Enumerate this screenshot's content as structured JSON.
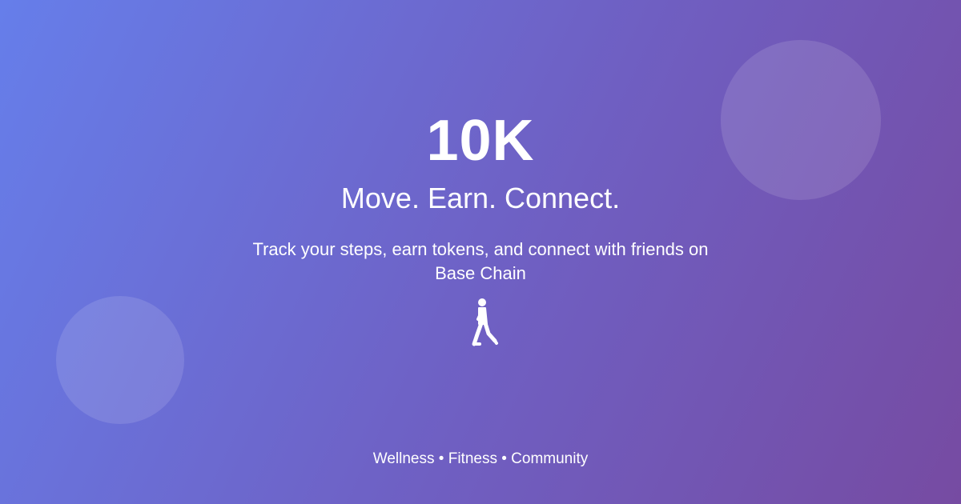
{
  "brand": {
    "title": "10K",
    "tagline": "Move. Earn. Connect.",
    "description": "Track your steps, earn tokens, and connect with friends on Base Chain"
  },
  "hero_icon": "walking-person-icon",
  "footer": {
    "text": "Wellness • Fitness • Community"
  },
  "colors": {
    "gradient_start": "#667eea",
    "gradient_end": "#764ba2",
    "text": "#ffffff"
  }
}
